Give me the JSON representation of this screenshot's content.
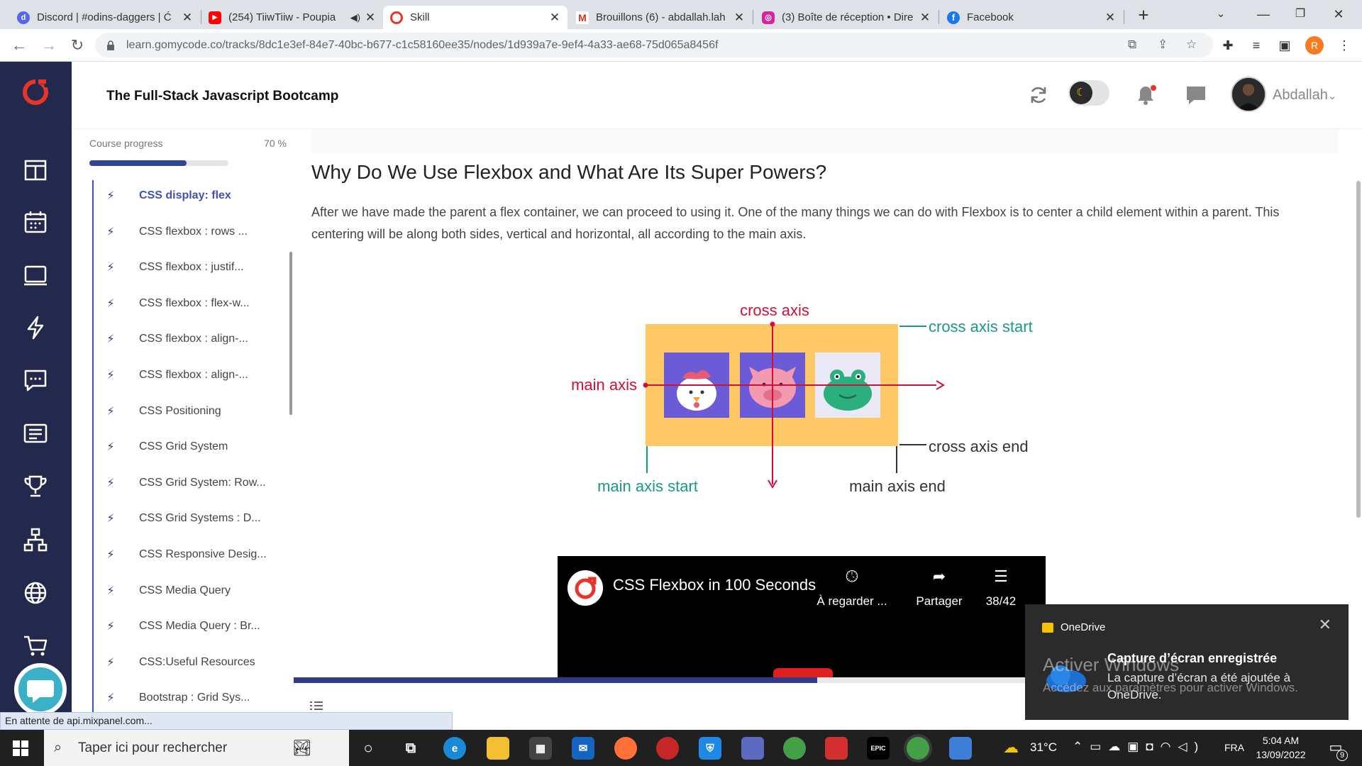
{
  "browser": {
    "tabs": [
      {
        "title": "Discord | #odins-daggers | Ć",
        "favicon_color": "#5865f2",
        "favicon_glyph": "d"
      },
      {
        "title": "(254) TiiwTiiw - Poupia",
        "favicon_color": "#ff0000",
        "favicon_glyph": "▶"
      },
      {
        "title": "Skill",
        "favicon_color": "#e8352c",
        "favicon_glyph": "o"
      },
      {
        "title": "Brouillons (6) - abdallah.lah",
        "favicon_color": "#ffffff",
        "favicon_glyph": "M"
      },
      {
        "title": "(3) Boîte de réception • Dire",
        "favicon_color": "#d6249f",
        "favicon_glyph": "◎"
      },
      {
        "title": "Facebook",
        "favicon_color": "#1877f2",
        "favicon_glyph": "f"
      }
    ],
    "url": "learn.gomycode.co/tracks/8dc1e3ef-84e7-40bc-b677-c1c58160ee35/nodes/1d939a7e-9ef4-4a33-ae68-75d065a8456f",
    "profile_initial": "R",
    "status_text": "En attente de api.mixpanel.com..."
  },
  "header": {
    "course_title": "The Full-Stack Javascript Bootcamp",
    "username": "Abdallah"
  },
  "sidebar": {
    "progress_label": "Course progress",
    "progress_text": "70 %",
    "progress": 0.7,
    "lessons": [
      {
        "label": "CSS display: flex",
        "current": true
      },
      {
        "label": "CSS flexbox : rows ..."
      },
      {
        "label": "CSS flexbox : justif..."
      },
      {
        "label": "CSS flexbox : flex-w..."
      },
      {
        "label": "CSS flexbox : align-..."
      },
      {
        "label": "CSS flexbox : align-..."
      },
      {
        "label": "CSS Positioning"
      },
      {
        "label": "CSS Grid System"
      },
      {
        "label": "CSS Grid System: Row..."
      },
      {
        "label": "CSS Grid Systems : D..."
      },
      {
        "label": "CSS Responsive Desig..."
      },
      {
        "label": "CSS Media Query"
      },
      {
        "label": "CSS Media Query : Br..."
      },
      {
        "label": "CSS:Useful Resources"
      },
      {
        "label": "Bootstrap : Grid Sys..."
      }
    ]
  },
  "content": {
    "title": "Why Do We Use Flexbox and What Are Its Super Powers?",
    "paragraph": "After we have made the parent a flex container, we can proceed to using it. One of the many things we can do with Flexbox is to center a child element within a parent. This centering will be along both sides, vertical and horizontal, all according to the main axis.",
    "diagram": {
      "cross_axis": "cross axis",
      "cross_axis_start": "cross axis start",
      "cross_axis_end": "cross axis end",
      "main_axis": "main axis",
      "main_axis_start": "main axis start",
      "main_axis_end": "main axis end",
      "items": [
        "chicken",
        "pig",
        "frog"
      ]
    },
    "video": {
      "title": "CSS Flexbox in 100 Seconds",
      "watch_later": "À regarder ...",
      "share": "Partager",
      "playlist": "38/42"
    },
    "page_progress": 0.69
  },
  "toast": {
    "app": "OneDrive",
    "heading": "Capture d’écran enregistrée",
    "body": "La capture d’écran a été ajoutée à OneDrive."
  },
  "watermark": {
    "line1": "Activer Windows",
    "line2": "Accédez aux paramètres pour activer Windows."
  },
  "taskbar": {
    "search_placeholder": "Taper ici pour rechercher",
    "temperature": "31°C",
    "language": "FRA",
    "time": "5:04 AM",
    "date": "13/09/2022",
    "notification_count": "9"
  },
  "colors": {
    "rail": "#23294d",
    "accent": "#3f51b5",
    "axis_red": "#d0103a",
    "axis_teal": "#1a9a86",
    "box": "#ffc866"
  }
}
